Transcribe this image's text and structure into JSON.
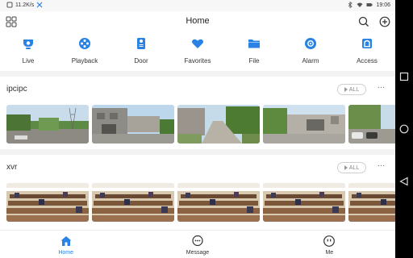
{
  "status_bar": {
    "net_speed": "11.2K/s",
    "time": "19:06",
    "battery_icon": "battery-icon",
    "wifi_icon": "wifi-icon"
  },
  "header": {
    "title": "Home",
    "left_icon": "apps-grid-icon",
    "right_icons": [
      "search-icon",
      "add-circle-icon"
    ]
  },
  "quick_nav": [
    {
      "label": "Live",
      "icon": "camera-icon"
    },
    {
      "label": "Playback",
      "icon": "film-reel-icon"
    },
    {
      "label": "Door",
      "icon": "door-phone-icon"
    },
    {
      "label": "Favorites",
      "icon": "heart-icon"
    },
    {
      "label": "File",
      "icon": "folder-icon"
    },
    {
      "label": "Alarm",
      "icon": "alarm-bell-icon"
    },
    {
      "label": "Access",
      "icon": "access-door-icon"
    }
  ],
  "sections": [
    {
      "name": "ipcipc",
      "all_label": "ALL",
      "more": "…",
      "thumbnail_count": 5,
      "scene": "outdoor"
    },
    {
      "name": "xvr",
      "all_label": "ALL",
      "more": "…",
      "thumbnail_count": 5,
      "scene": "indoor"
    }
  ],
  "tabs": [
    {
      "label": "Home",
      "icon": "home-icon",
      "active": true
    },
    {
      "label": "Message",
      "icon": "message-bubble-icon",
      "active": false
    },
    {
      "label": "Me",
      "icon": "profile-icon",
      "active": false
    }
  ],
  "colors": {
    "accent": "#2a82e4",
    "background": "#ffffff",
    "band": "#f2f2f2"
  }
}
